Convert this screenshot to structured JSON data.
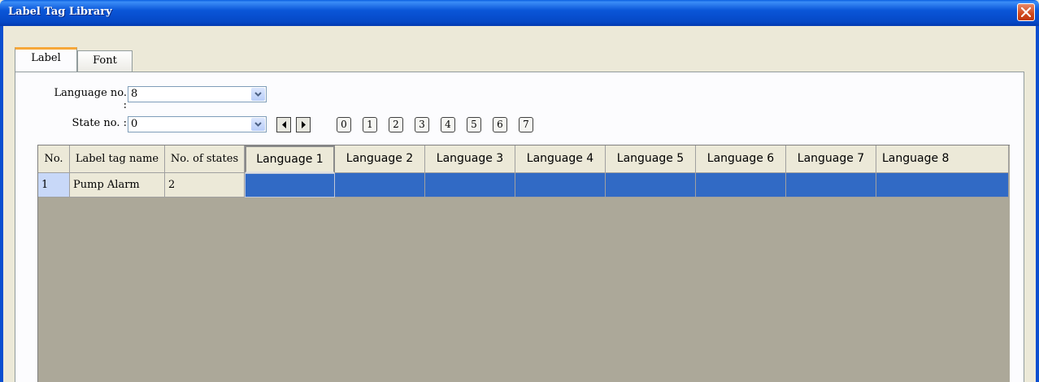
{
  "window": {
    "title": "Label Tag Library"
  },
  "tabs": [
    {
      "label": "Label"
    },
    {
      "label": "Font"
    }
  ],
  "language_no": {
    "label": "Language no. :",
    "value": "8"
  },
  "state_no": {
    "label": "State no. :",
    "value": "0"
  },
  "state_buttons": [
    "0",
    "1",
    "2",
    "3",
    "4",
    "5",
    "6",
    "7"
  ],
  "table": {
    "columns": [
      "No.",
      "Label tag name",
      "No. of states",
      "Language 1",
      "Language 2",
      "Language 3",
      "Language 4",
      "Language 5",
      "Language 6",
      "Language 7",
      "Language 8"
    ],
    "rows": [
      {
        "no": "1",
        "name": "Pump Alarm",
        "states": "2",
        "languages": [
          "",
          "",
          "",
          "",
          "",
          "",
          "",
          ""
        ]
      }
    ]
  },
  "colors": {
    "titlebar": "#0a56d8",
    "selection": "#316ac5",
    "grid_bg": "#aca899",
    "close_button": "#d0481c"
  },
  "icons": [
    "close-icon",
    "chevron-down-icon",
    "arrow-left-icon",
    "arrow-right-icon"
  ]
}
